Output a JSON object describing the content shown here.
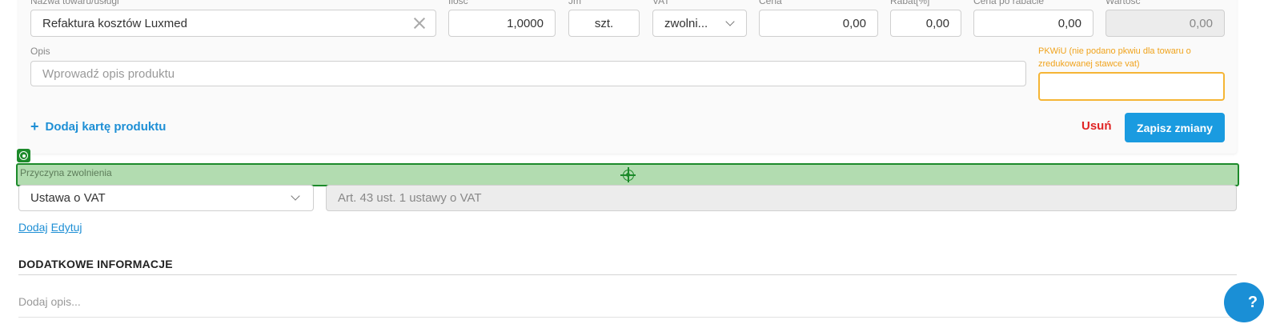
{
  "item": {
    "name_label": "Nazwa towaru/usługi",
    "name_value": "Refaktura kosztów Luxmed",
    "qty_label": "Ilość",
    "qty_value": "1,0000",
    "unit_label": "Jm",
    "unit_value": "szt.",
    "vat_label": "VAT",
    "vat_value": "zwolni...",
    "price_label": "Cena",
    "price_value": "0,00",
    "discount_label": "Rabat[%]",
    "discount_value": "0,00",
    "net_price_label": "Cena po rabacie",
    "net_price_value": "0,00",
    "total_label": "Wartość",
    "total_value": "0,00",
    "desc_label": "Opis",
    "desc_placeholder": "Wprowadź opis produktu",
    "pkwiu_label": "PKWiU (nie podano pkwiu dla towaru o zredukowanej stawce vat)",
    "pkwiu_value": "",
    "add_card_label": "Dodaj kartę produktu",
    "remove_label": "Usuń",
    "save_label": "Zapisz zmiany"
  },
  "exemption": {
    "label": "Przyczyna zwolnienia",
    "basis_value": "Ustawa o VAT",
    "article_value": "Art. 43 ust. 1 ustawy o VAT",
    "add_link": "Dodaj",
    "edit_link": "Edytuj"
  },
  "additional": {
    "title": "DODATKOWE INFORMACJE",
    "desc_placeholder": "Dodaj opis..."
  },
  "help": {
    "label": "?"
  },
  "colors": {
    "accent": "#1a9be0",
    "danger": "#e02424",
    "warning": "#f0a31c",
    "highlight_fill": "#b2dcb0",
    "highlight_border": "#1c8a2a"
  }
}
